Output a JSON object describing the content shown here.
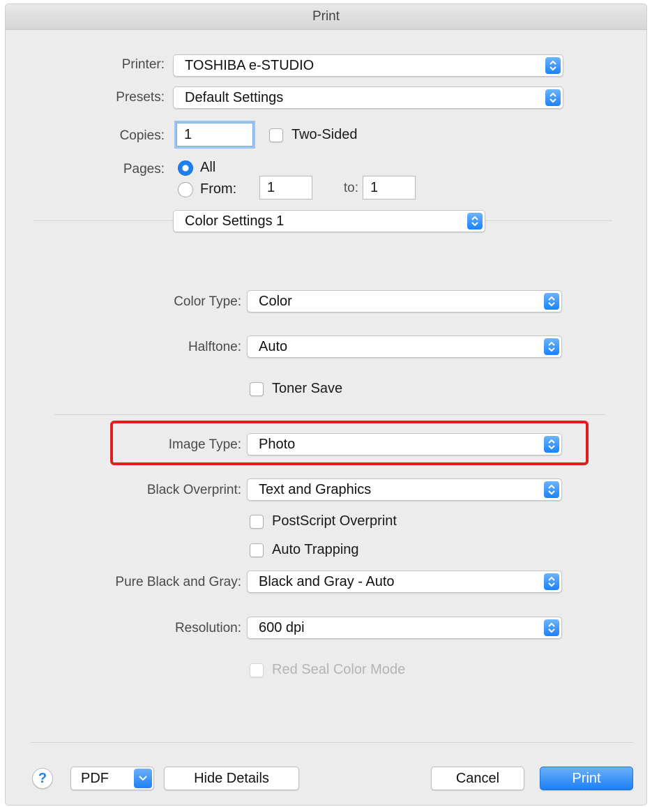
{
  "window": {
    "title": "Print"
  },
  "printer": {
    "label": "Printer:",
    "value": "TOSHIBA e-STUDIO"
  },
  "presets": {
    "label": "Presets:",
    "value": "Default Settings"
  },
  "copies": {
    "label": "Copies:",
    "value": "1",
    "two_sided_label": "Two-Sided",
    "two_sided_checked": false
  },
  "pages": {
    "label": "Pages:",
    "all_label": "All",
    "from_label": "From:",
    "from_value": "1",
    "to_label": "to:",
    "to_value": "1",
    "selected": "All"
  },
  "section_popup": {
    "value": "Color Settings 1"
  },
  "color_type": {
    "label": "Color Type:",
    "value": "Color"
  },
  "halftone": {
    "label": "Halftone:",
    "value": "Auto"
  },
  "toner_save": {
    "label": "Toner Save",
    "checked": false
  },
  "image_type": {
    "label": "Image Type:",
    "value": "Photo",
    "highlight_color": "#e01e1e"
  },
  "black_overprint": {
    "label": "Black Overprint:",
    "value": "Text and Graphics"
  },
  "postscript_overprint": {
    "label": "PostScript Overprint",
    "checked": false
  },
  "auto_trapping": {
    "label": "Auto Trapping",
    "checked": false
  },
  "pure_black_gray": {
    "label": "Pure Black and Gray:",
    "value": "Black and Gray - Auto"
  },
  "resolution": {
    "label": "Resolution:",
    "value": "600 dpi"
  },
  "red_seal": {
    "label": "Red Seal Color Mode",
    "checked": false,
    "enabled": false
  },
  "footer": {
    "help_symbol": "?",
    "pdf_label": "PDF",
    "hide_details_label": "Hide Details",
    "cancel_label": "Cancel",
    "print_label": "Print"
  },
  "colors": {
    "accent": "#1e80f0",
    "window_bg": "#ececec"
  }
}
